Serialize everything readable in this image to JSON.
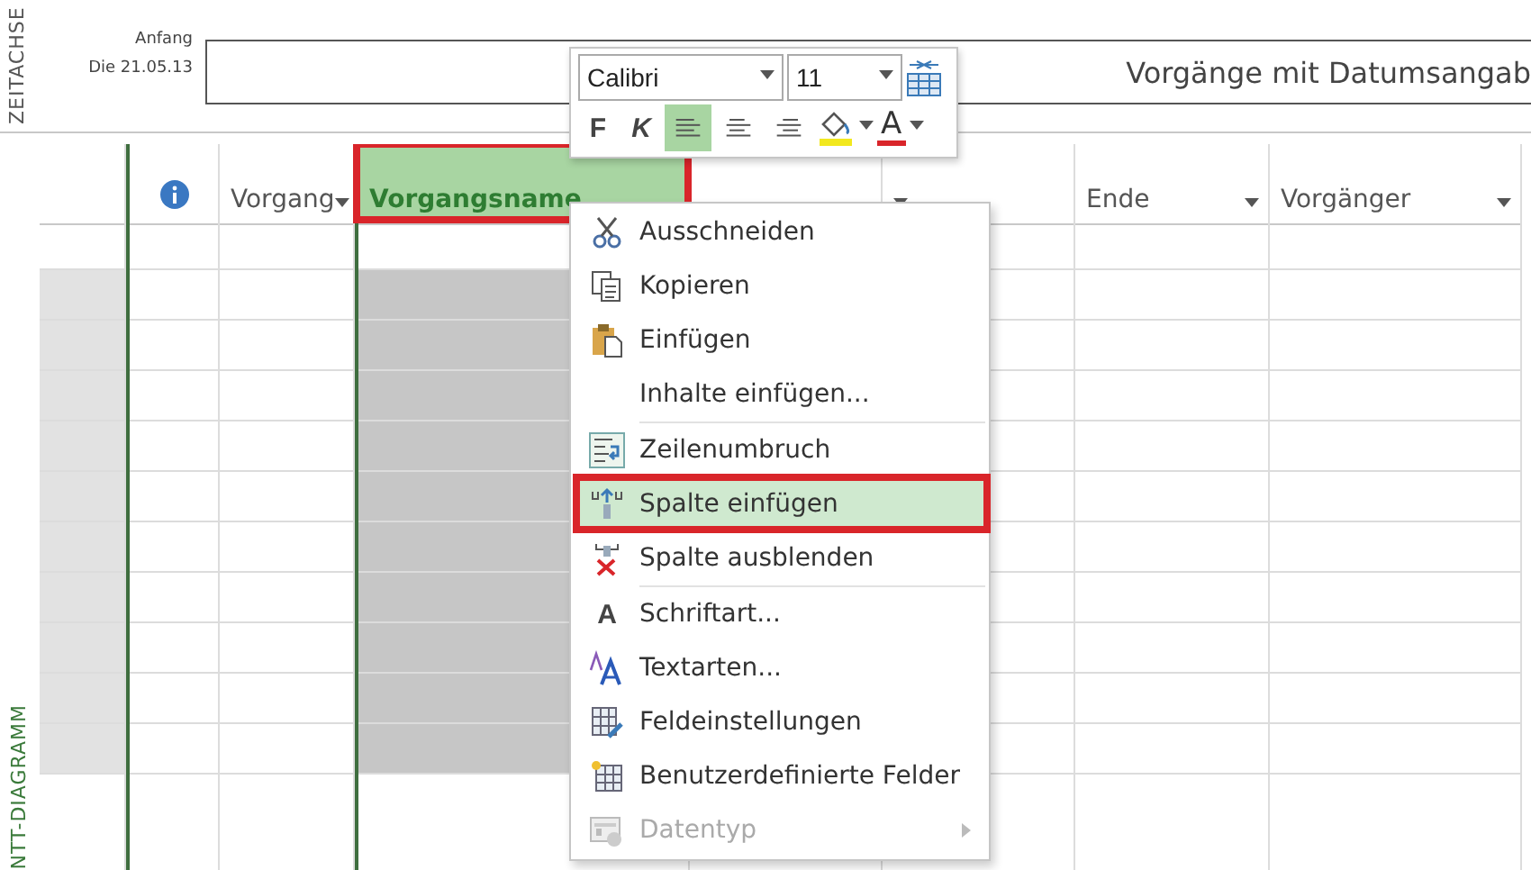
{
  "timeline": {
    "side_label": "ZEITACHSE",
    "start_label": "Anfang",
    "start_date": "Die 21.05.13",
    "title": "Vorgänge mit Datumsangab"
  },
  "gantt": {
    "side_label": "NTT-DIAGRAMM"
  },
  "table": {
    "columns": [
      {
        "kind": "rowhead"
      },
      {
        "kind": "info"
      },
      {
        "kind": "text",
        "label": "Vorgang",
        "dropdown": true,
        "selected": false
      },
      {
        "kind": "text",
        "label": "Vorgangsname",
        "selected": true,
        "outlined": true
      },
      {
        "kind": "text"
      },
      {
        "kind": "text",
        "dropdown": true
      },
      {
        "kind": "text",
        "label": "Ende",
        "dropdown": true,
        "selected": false
      },
      {
        "kind": "text",
        "label": "Vorgänger",
        "dropdown": true,
        "selected": false
      }
    ]
  },
  "mini_toolbar": {
    "font": "Calibri",
    "size": "11",
    "bold": "F",
    "italic": "K",
    "alignments": [
      {
        "kind": "left",
        "selected": true
      },
      {
        "kind": "center",
        "selected": false
      },
      {
        "kind": "right",
        "selected": false
      }
    ],
    "font_color_glyph": "A"
  },
  "context_menu": {
    "groups": [
      [
        {
          "kind": "cut",
          "label": "Ausschneiden",
          "selected": false,
          "disabled": false
        },
        {
          "kind": "copy",
          "label": "Kopieren",
          "selected": false,
          "disabled": false
        },
        {
          "kind": "paste",
          "label": "Einfügen",
          "selected": false,
          "disabled": false
        },
        {
          "kind": "none",
          "label": "Inhalte einfügen...",
          "selected": false,
          "disabled": false
        }
      ],
      [
        {
          "kind": "wrap",
          "label": "Zeilenumbruch",
          "selected": false,
          "disabled": false
        },
        {
          "kind": "insert",
          "label": "Spalte einfügen",
          "selected": true,
          "disabled": false,
          "outlined": true
        },
        {
          "kind": "hide",
          "label": "Spalte ausblenden",
          "selected": false,
          "disabled": false
        }
      ],
      [
        {
          "kind": "font",
          "label": "Schriftart...",
          "glyph": "A",
          "selected": false,
          "disabled": false
        },
        {
          "kind": "styles",
          "label": "Textarten...",
          "selected": false,
          "disabled": false
        },
        {
          "kind": "fieldsettings",
          "label": "Feldeinstellungen",
          "selected": false,
          "disabled": false
        },
        {
          "kind": "customfields",
          "label": "Benutzerdefinierte Felder",
          "selected": false,
          "disabled": false
        },
        {
          "kind": "datatype",
          "label": "Datentyp",
          "selected": false,
          "disabled": true,
          "submenu": true
        }
      ]
    ]
  }
}
